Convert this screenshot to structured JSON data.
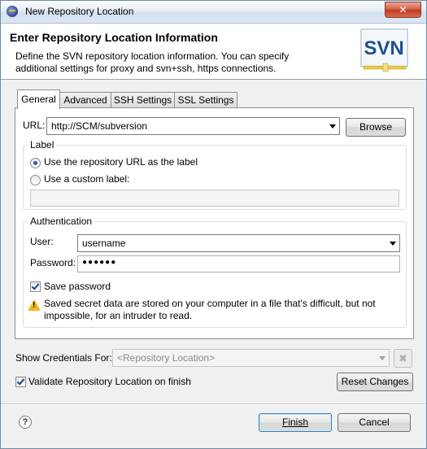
{
  "window": {
    "title": "New Repository Location",
    "close_glyph": "✕"
  },
  "header": {
    "title": "Enter Repository Location Information",
    "description": "Define the SVN repository location information. You can specify\n additional settings for proxy and svn+ssh, https connections.",
    "logo_text": "SVN"
  },
  "tabs": [
    {
      "label": "General",
      "active": true
    },
    {
      "label": "Advanced",
      "active": false
    },
    {
      "label": "SSH Settings",
      "active": false
    },
    {
      "label": "SSL Settings",
      "active": false
    }
  ],
  "general": {
    "url_label": "URL:",
    "url_value": "http://SCM/subversion",
    "browse_label": "Browse",
    "label_group": {
      "title": "Label",
      "option_url": "Use the repository URL as the label",
      "option_custom": "Use a custom label:",
      "selected": "url",
      "custom_value": ""
    },
    "auth_group": {
      "title": "Authentication",
      "user_label": "User:",
      "user_value": "username",
      "password_label": "Password:",
      "password_value": "●●●●●●",
      "save_password_label": "Save password",
      "save_password_checked": true,
      "warning_text": "Saved secret data are stored on your computer in a file that's difficult, but not impossible, for an intruder to read."
    }
  },
  "credentials": {
    "label": "Show Credentials For:",
    "value": "<Repository Location>",
    "delete_glyph": "✖"
  },
  "validate": {
    "label": "Validate Repository Location on finish",
    "checked": true
  },
  "reset_label": "Reset Changes",
  "footer": {
    "help_glyph": "?",
    "finish_label": "Finish",
    "cancel_label": "Cancel"
  },
  "colors": {
    "titlebar": "#dbe6f2",
    "logo_blue": "#1d4f94",
    "logo_bar": "#e9c84a",
    "warning": "#f2b521"
  }
}
